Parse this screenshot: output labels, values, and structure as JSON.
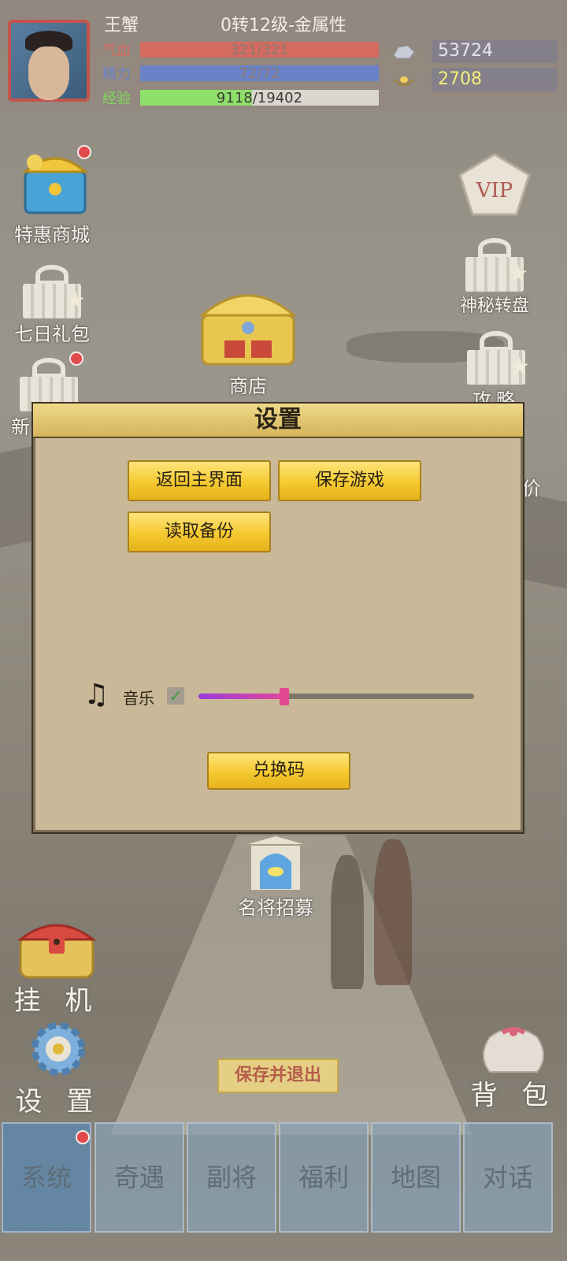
{
  "header": {
    "name": "王蟹",
    "level": "0转12级-金属性",
    "stats": [
      {
        "label": "气血",
        "value": "321/321",
        "fill": 1.0,
        "color": "#d46a60",
        "label_color": "#d46a60"
      },
      {
        "label": "精力",
        "value": "72/72",
        "fill": 1.0,
        "color": "#6a82c8",
        "label_color": "#6a82c8"
      },
      {
        "label": "经验",
        "value": "9118/19402",
        "fill": 0.47,
        "color": "#8ee06a",
        "label_color": "#7ed85a"
      }
    ],
    "silver": {
      "icon": "silver-ingot-icon",
      "value": "53724",
      "color": "#e7e4ef"
    },
    "gold": {
      "icon": "gold-ingot-icon",
      "value": "2708",
      "color": "#f4ee7a"
    }
  },
  "left_icons": [
    {
      "label": "特惠商城",
      "icon": "treasure-chest-icon",
      "dot": true
    },
    {
      "label": "七日礼包",
      "icon": "gift-icon",
      "dot": false
    },
    {
      "label": "新",
      "icon": "gift-icon",
      "dot": true
    }
  ],
  "right_icons": [
    {
      "label": "",
      "icon": "vip-badge-icon"
    },
    {
      "label": "神秘转盘",
      "icon": "gift-icon"
    },
    {
      "label": "攻略",
      "icon": "gift-icon"
    },
    {
      "label": "价",
      "icon": "partial-icon"
    }
  ],
  "center": {
    "shop_label": "商店",
    "recruit_label": "名将招募"
  },
  "settings_modal": {
    "title": "设置",
    "buttons": {
      "return_main": "返回主界面",
      "save_game": "保存游戏",
      "load_backup": "读取备份",
      "redeem_code": "兑换码"
    },
    "music": {
      "label": "音乐",
      "enabled": true,
      "volume": 0.31
    }
  },
  "bottom": {
    "idle_label": "挂 机",
    "settings_label": "设 置",
    "bag_label": "背 包",
    "save_exit": "保存并退出"
  },
  "tabs": [
    {
      "label": "系统",
      "active": true,
      "dot": true
    },
    {
      "label": "奇遇",
      "active": false,
      "dot": false
    },
    {
      "label": "副将",
      "active": false,
      "dot": false
    },
    {
      "label": "福利",
      "active": false,
      "dot": false
    },
    {
      "label": "地图",
      "active": false,
      "dot": false
    },
    {
      "label": "对话",
      "active": false,
      "dot": false
    }
  ]
}
